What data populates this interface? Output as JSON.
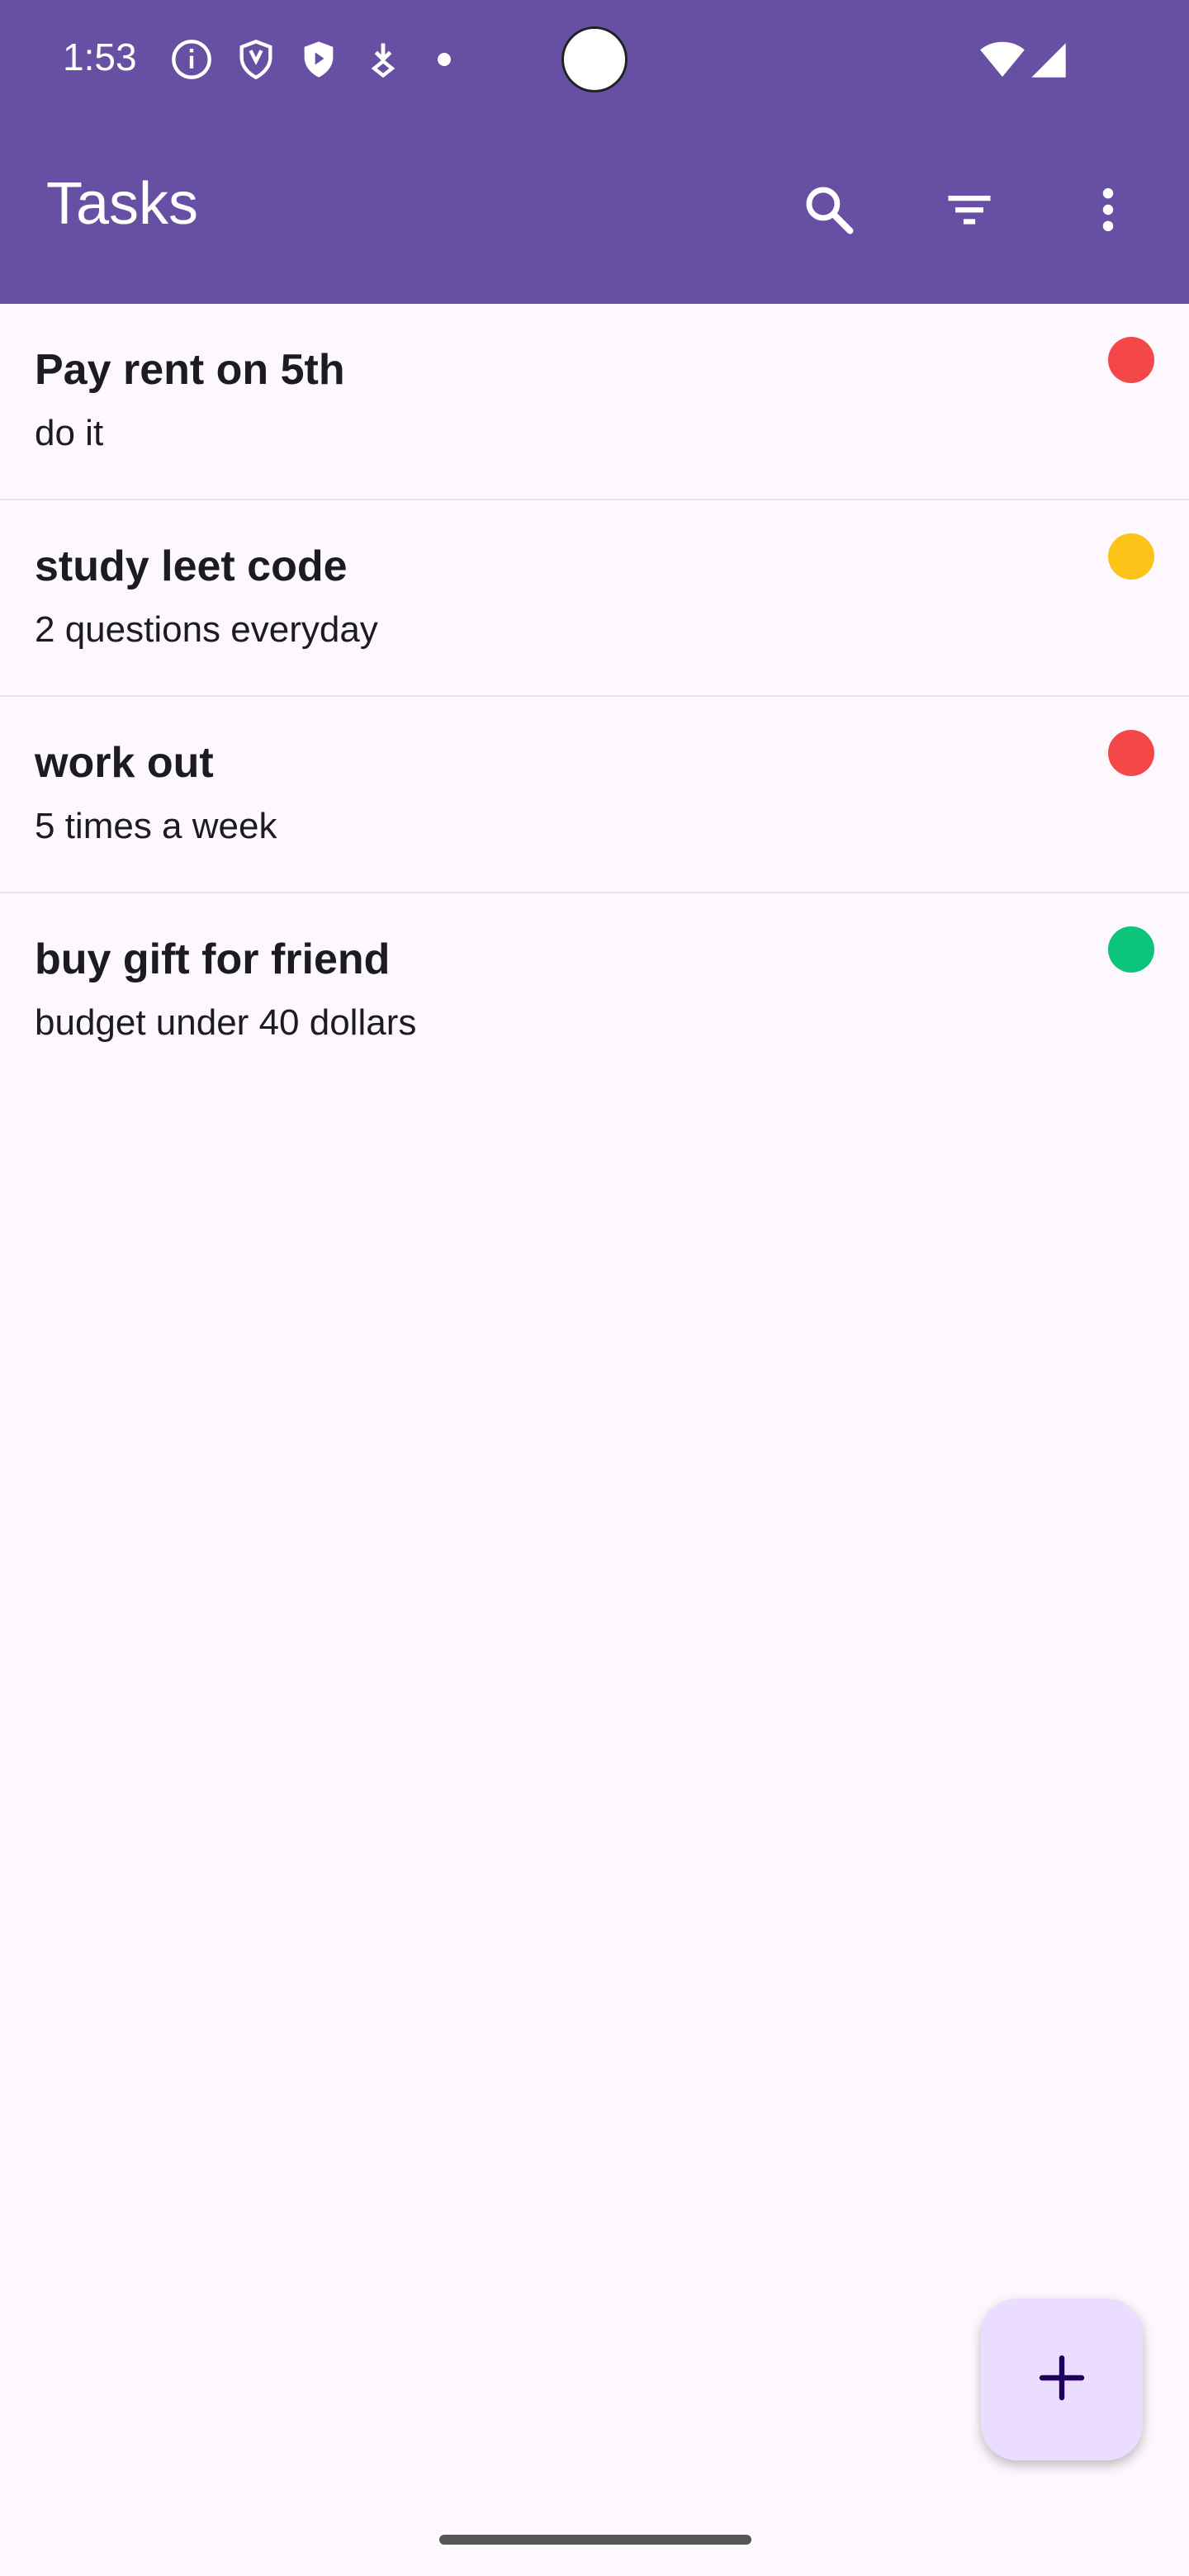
{
  "status_bar": {
    "time": "1:53",
    "icons": [
      "info-icon",
      "shield-icon",
      "play-shield-icon",
      "download-icon",
      "dot-icon",
      "wifi-icon",
      "signal-icon"
    ]
  },
  "app_bar": {
    "title": "Tasks",
    "actions": [
      "search-icon",
      "filter-icon",
      "more-vert-icon"
    ]
  },
  "tasks": [
    {
      "title": "Pay rent on 5th",
      "description": "do it",
      "priority_color": "#f44848"
    },
    {
      "title": "study leet code",
      "description": "2 questions everyday",
      "priority_color": "#fcc419"
    },
    {
      "title": "work out",
      "description": "5 times a week",
      "priority_color": "#f44848"
    },
    {
      "title": "buy gift for friend",
      "description": "budget under 40 dollars",
      "priority_color": "#0cc47a"
    }
  ],
  "fab": {
    "icon": "plus-icon"
  },
  "colors": {
    "primary": "#6750a4",
    "background": "#fdf8fd",
    "fab_background": "#eaddff",
    "fab_icon": "#21005d"
  }
}
